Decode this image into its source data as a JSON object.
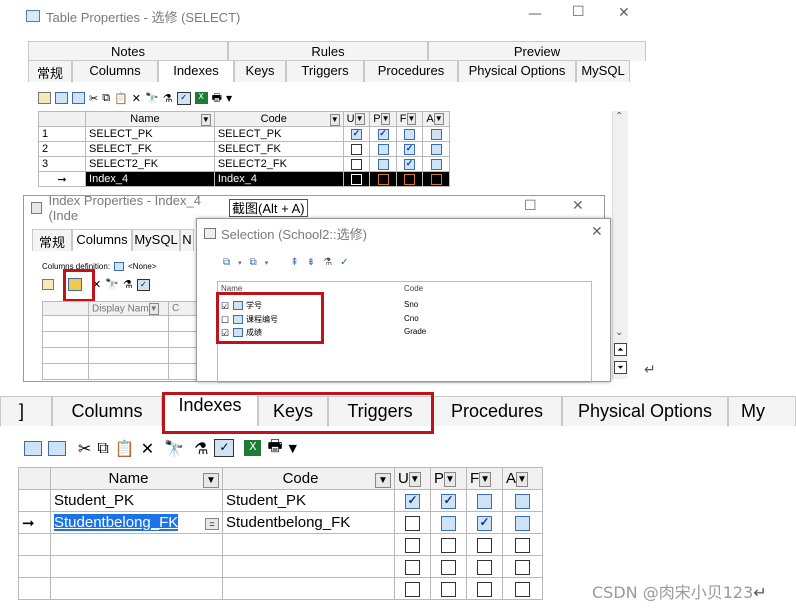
{
  "top_window": {
    "title": "Table Properties - 选修 (SELECT)",
    "controls": {
      "minimize": "—",
      "maximize": "☐",
      "close": "✕"
    },
    "tabs_row1": [
      "Notes",
      "Rules",
      "Preview"
    ],
    "tabs_row2": [
      "常规",
      "Columns",
      "Indexes",
      "Keys",
      "Triggers",
      "Procedures",
      "Physical Options",
      "MySQL"
    ],
    "active_tab": "Indexes",
    "grid": {
      "columns": [
        "Name",
        "Code",
        "U",
        "P",
        "F",
        "A"
      ],
      "rows": [
        {
          "num": "1",
          "marker": "",
          "name": "SELECT_PK",
          "code": "SELECT_PK",
          "u": true,
          "p": true,
          "f": false,
          "a": false
        },
        {
          "num": "2",
          "marker": "",
          "name": "SELECT_FK",
          "code": "SELECT_FK",
          "u": false,
          "p": false,
          "f": true,
          "a": false
        },
        {
          "num": "3",
          "marker": "",
          "name": "SELECT2_FK",
          "code": "SELECT2_FK",
          "u": false,
          "p": false,
          "f": true,
          "a": false
        },
        {
          "num": "",
          "marker": "➞",
          "name": "Index_4",
          "code": "Index_4",
          "u": false,
          "p": false,
          "f": false,
          "a": false
        }
      ]
    }
  },
  "index_window": {
    "title": "Index Properties - Index_4 (Inde",
    "tooltip": "截图(Alt + A)",
    "tabs": [
      "常规",
      "Columns",
      "MySQL",
      "N"
    ],
    "active_tab": "Columns",
    "columns_definition_label": "Columns definition:",
    "columns_definition_value": "<None>",
    "grid_header": [
      "Display Nam",
      "C"
    ]
  },
  "selection_window": {
    "title": "Selection (School2::选修)",
    "close": "✕",
    "list_header": [
      "Name",
      "Code"
    ],
    "items": [
      {
        "name": "学号",
        "code": "Sno",
        "checked": true
      },
      {
        "name": "课程编号",
        "code": "Cno",
        "checked": false
      },
      {
        "name": "成绩",
        "code": "Grade",
        "checked": true
      }
    ]
  },
  "bottom_panel": {
    "tabs": [
      "Columns",
      "Indexes",
      "Keys",
      "Triggers",
      "Procedures",
      "Physical Options",
      "My"
    ],
    "first_tab_fragment": "]",
    "active_tab": "Indexes",
    "grid": {
      "columns": [
        "Name",
        "Code",
        "U",
        "P",
        "F",
        "A"
      ],
      "rows": [
        {
          "marker": "",
          "name": "Student_PK",
          "code": "Student_PK",
          "u": true,
          "p": true,
          "f": false,
          "a": false
        },
        {
          "marker": "➞",
          "name": "Studentbelong_FK",
          "code": "Studentbelong_FK",
          "u": false,
          "p": false,
          "f": true,
          "a": false
        },
        {
          "marker": "",
          "name": "",
          "code": "",
          "u": false,
          "p": false,
          "f": false,
          "a": false
        },
        {
          "marker": "",
          "name": "",
          "code": "",
          "u": false,
          "p": false,
          "f": false,
          "a": false
        },
        {
          "marker": "",
          "name": "",
          "code": "",
          "u": false,
          "p": false,
          "f": false,
          "a": false
        }
      ]
    }
  },
  "watermark": "CSDN @肉宋小贝123",
  "return_mark": "↵",
  "icons": {
    "toolbar": [
      "properties-icon",
      "add-row-icon",
      "insert-row-icon",
      "cut-icon",
      "copy-icon",
      "paste-icon",
      "delete-icon",
      "find-icon",
      "filter-icon",
      "customize-columns-icon",
      "excel-icon",
      "print-icon",
      "dropdown-icon"
    ],
    "colors": {
      "highlight_red": "#c0121a",
      "selected_row": "#000000",
      "check_blue": "#3b6db6",
      "name_selected": "#1a73e8"
    }
  }
}
